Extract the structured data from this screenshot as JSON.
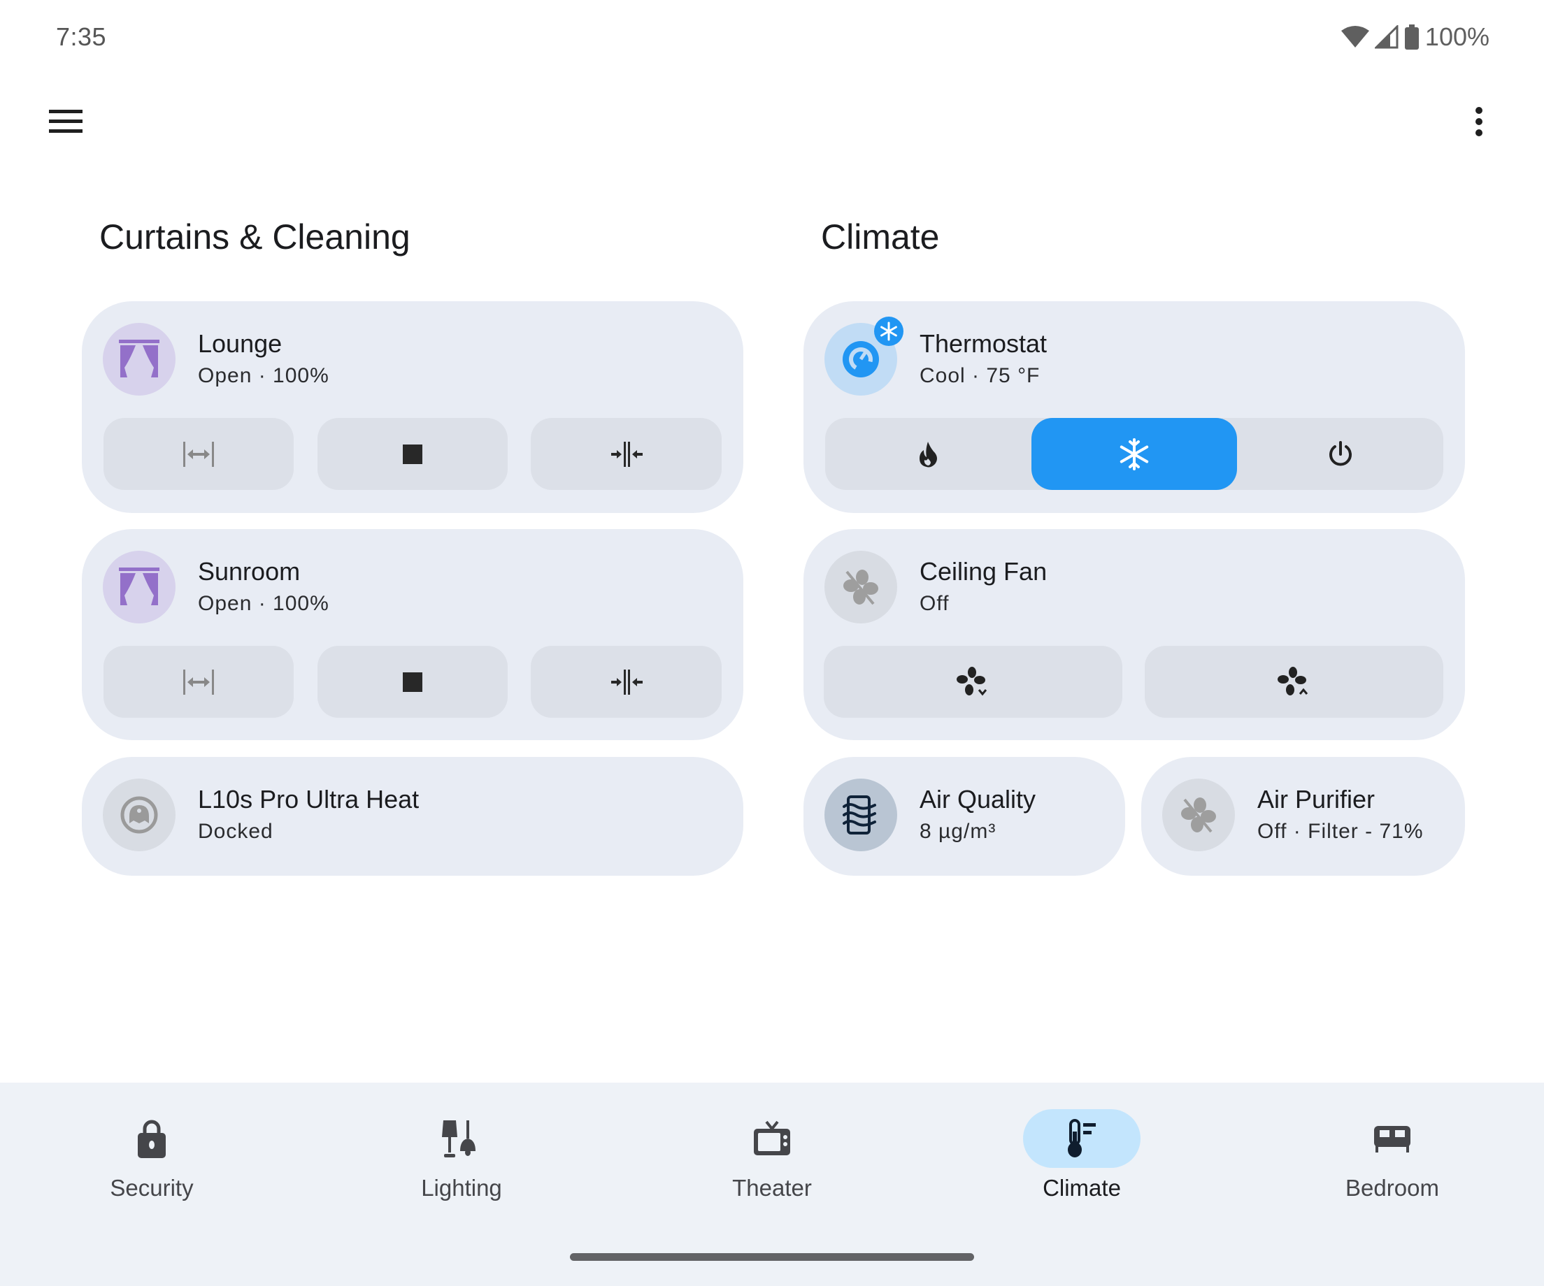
{
  "status_bar": {
    "time": "7:35",
    "battery_percent": "100%",
    "icons": [
      "wifi-icon",
      "cell-signal-icon",
      "battery-icon"
    ]
  },
  "top_bar": {
    "menu_icon": "hamburger-menu-icon",
    "more_icon": "more-vert-icon"
  },
  "sections": {
    "left": {
      "title": "Curtains & Cleaning",
      "cards": [
        {
          "name": "Lounge",
          "state": "Open · 100%",
          "icon": "curtains-icon",
          "accent": "#9370c9",
          "buttons": [
            {
              "icon": "curtain-open-icon",
              "label": "Open",
              "disabled": true
            },
            {
              "icon": "stop-icon",
              "label": "Stop"
            },
            {
              "icon": "curtain-close-icon",
              "label": "Close"
            }
          ]
        },
        {
          "name": "Sunroom",
          "state": "Open · 100%",
          "icon": "curtains-icon",
          "accent": "#9370c9",
          "buttons": [
            {
              "icon": "curtain-open-icon",
              "label": "Open",
              "disabled": true
            },
            {
              "icon": "stop-icon",
              "label": "Stop"
            },
            {
              "icon": "curtain-close-icon",
              "label": "Close"
            }
          ]
        },
        {
          "name": "L10s Pro Ultra Heat",
          "state": "Docked",
          "icon": "robot-vacuum-icon"
        }
      ]
    },
    "right": {
      "title": "Climate",
      "cards": [
        {
          "name": "Thermostat",
          "state": "Cool · 75 °F",
          "icon": "thermostat-icon",
          "badge_icon": "snowflake-icon",
          "accent": "#2196f3",
          "modes": [
            {
              "icon": "fire-icon",
              "label": "Heat",
              "active": false
            },
            {
              "icon": "snowflake-icon",
              "label": "Cool",
              "active": true
            },
            {
              "icon": "power-icon",
              "label": "Off",
              "active": false
            }
          ]
        },
        {
          "name": "Ceiling Fan",
          "state": "Off",
          "icon": "fan-off-icon",
          "buttons": [
            {
              "icon": "fan-speed-down-icon",
              "label": "Decrease speed"
            },
            {
              "icon": "fan-speed-up-icon",
              "label": "Increase speed"
            }
          ]
        },
        {
          "name": "Air Quality",
          "state": "8 µg/m³",
          "icon": "air-filter-icon"
        },
        {
          "name": "Air Purifier",
          "state": "Off · Filter - 71%",
          "icon": "fan-off-icon"
        }
      ]
    }
  },
  "bottom_nav": {
    "items": [
      {
        "label": "Security",
        "icon": "lock-icon",
        "active": false
      },
      {
        "label": "Lighting",
        "icon": "lamps-icon",
        "active": false
      },
      {
        "label": "Theater",
        "icon": "tv-icon",
        "active": false
      },
      {
        "label": "Climate",
        "icon": "thermometer-icon",
        "active": true
      },
      {
        "label": "Bedroom",
        "icon": "bed-icon",
        "active": false
      }
    ]
  }
}
